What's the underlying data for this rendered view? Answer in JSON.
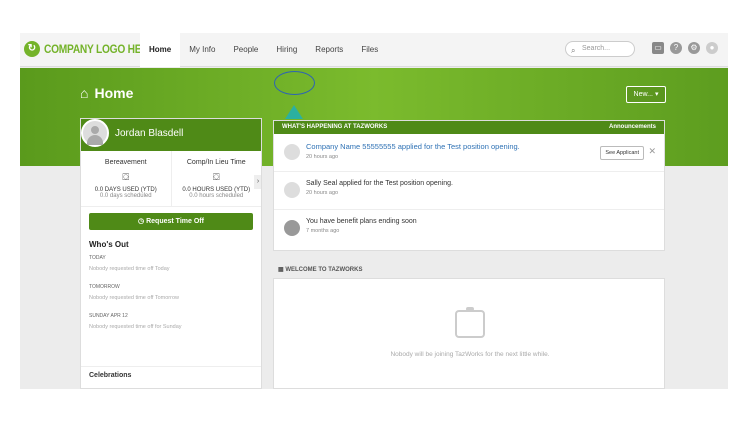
{
  "brand": {
    "logo_text": "COMPANY LOGO HERE",
    "accent": "#74b32a"
  },
  "nav": {
    "items": [
      {
        "label": "Home",
        "active": true
      },
      {
        "label": "My Info"
      },
      {
        "label": "People"
      },
      {
        "label": "Hiring"
      },
      {
        "label": "Reports"
      },
      {
        "label": "Files"
      }
    ],
    "search_placeholder": "Search..."
  },
  "header": {
    "title": "Home",
    "new_button": "New..."
  },
  "profile": {
    "name": "Jordan Blasdell",
    "leave": [
      {
        "title": "Bereavement",
        "used": "0.0 DAYS USED (YTD)",
        "scheduled": "0.0 days scheduled"
      },
      {
        "title": "Comp/In Lieu Time",
        "used": "0.0 HOURS USED (YTD)",
        "scheduled": "0.0 hours scheduled"
      }
    ],
    "request_button": "Request Time Off"
  },
  "whos_out": {
    "title": "Who's Out",
    "days": [
      {
        "label": "TODAY",
        "message": "Nobody requested time off Today"
      },
      {
        "label": "TOMORROW",
        "message": "Nobody requested time off Tomorrow"
      },
      {
        "label": "SUNDAY APR 12",
        "message": "Nobody requested time off for Sunday"
      }
    ]
  },
  "celebrations": {
    "title": "Celebrations"
  },
  "happening": {
    "title": "WHAT'S HAPPENING AT TAZWORKS",
    "link": "Announcements",
    "items": [
      {
        "text": "Company Name 55555555 applied for the Test position opening.",
        "time": "20 hours ago",
        "button": "See Applicant"
      },
      {
        "text": "Sally Seal applied for the Test position opening.",
        "time": "20 hours ago"
      },
      {
        "text": "You have benefit plans ending soon",
        "time": "7 months ago"
      }
    ]
  },
  "welcome": {
    "title": "WELCOME TO TAZWORKS",
    "message": "Nobody will be joining TazWorks for the next little while."
  }
}
